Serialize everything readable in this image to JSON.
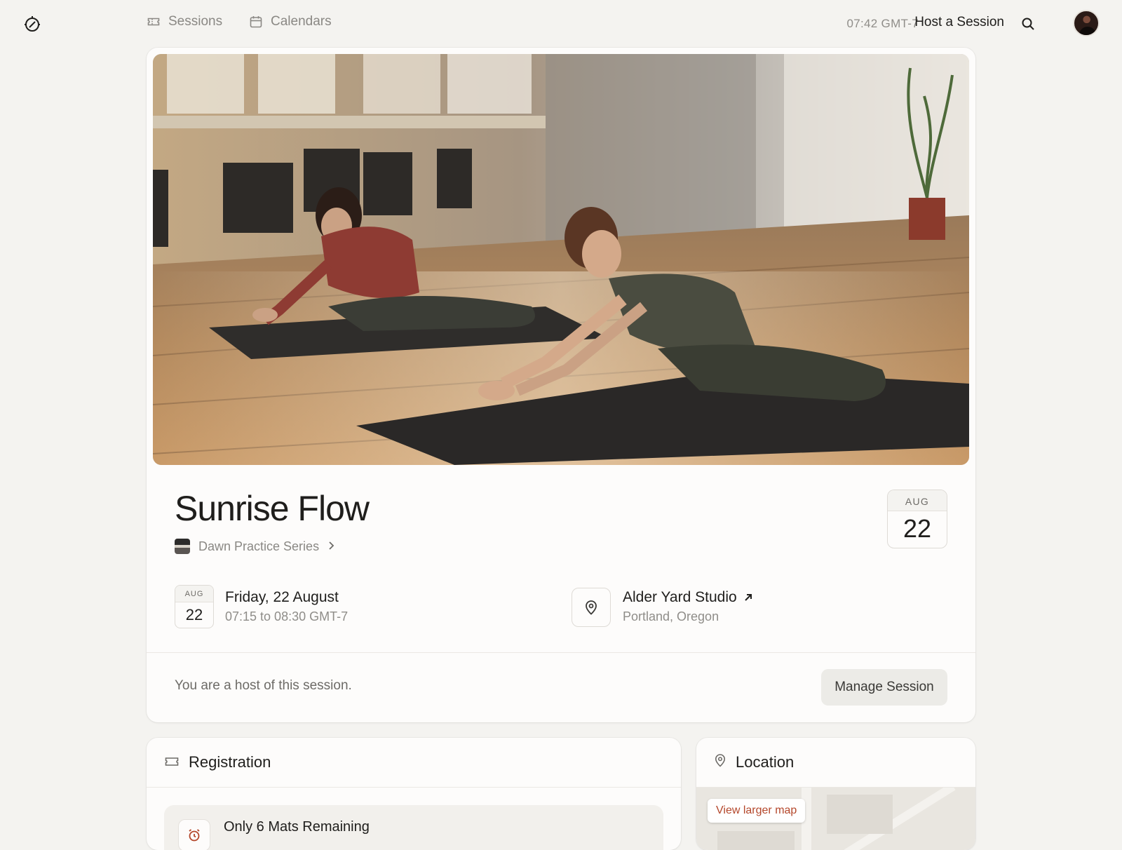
{
  "nav": {
    "sessions_label": "Sessions",
    "calendars_label": "Calendars",
    "clock": "07:42 GMT-7",
    "host_label": "Host a Session"
  },
  "event": {
    "title": "Sunrise Flow",
    "series": "Dawn Practice Series",
    "badge_month": "AUG",
    "badge_day": "22",
    "date_line": "Friday, 22 August",
    "time_line": "07:15 to 08:30 GMT-7",
    "venue_name": "Alder Yard Studio",
    "venue_city": "Portland, Oregon"
  },
  "host": {
    "note": "You are a host of this session.",
    "manage_label": "Manage Session"
  },
  "registration": {
    "heading": "Registration",
    "mats_remaining": "Only 6 Mats Remaining"
  },
  "location_card": {
    "heading": "Location",
    "map_button": "View larger map"
  },
  "icons": {
    "logo": "compass-logo-icon",
    "sessions": "ticket-icon",
    "calendars": "calendar-icon",
    "search": "search-icon",
    "location": "map-pin-icon",
    "external": "arrow-up-right-icon",
    "chevron": "chevron-right-icon",
    "alarm": "alarm-clock-icon"
  },
  "colors": {
    "background": "#f4f3f0",
    "card": "#fdfcfb",
    "accent": "#b4472b",
    "muted_text": "#8a8884"
  }
}
